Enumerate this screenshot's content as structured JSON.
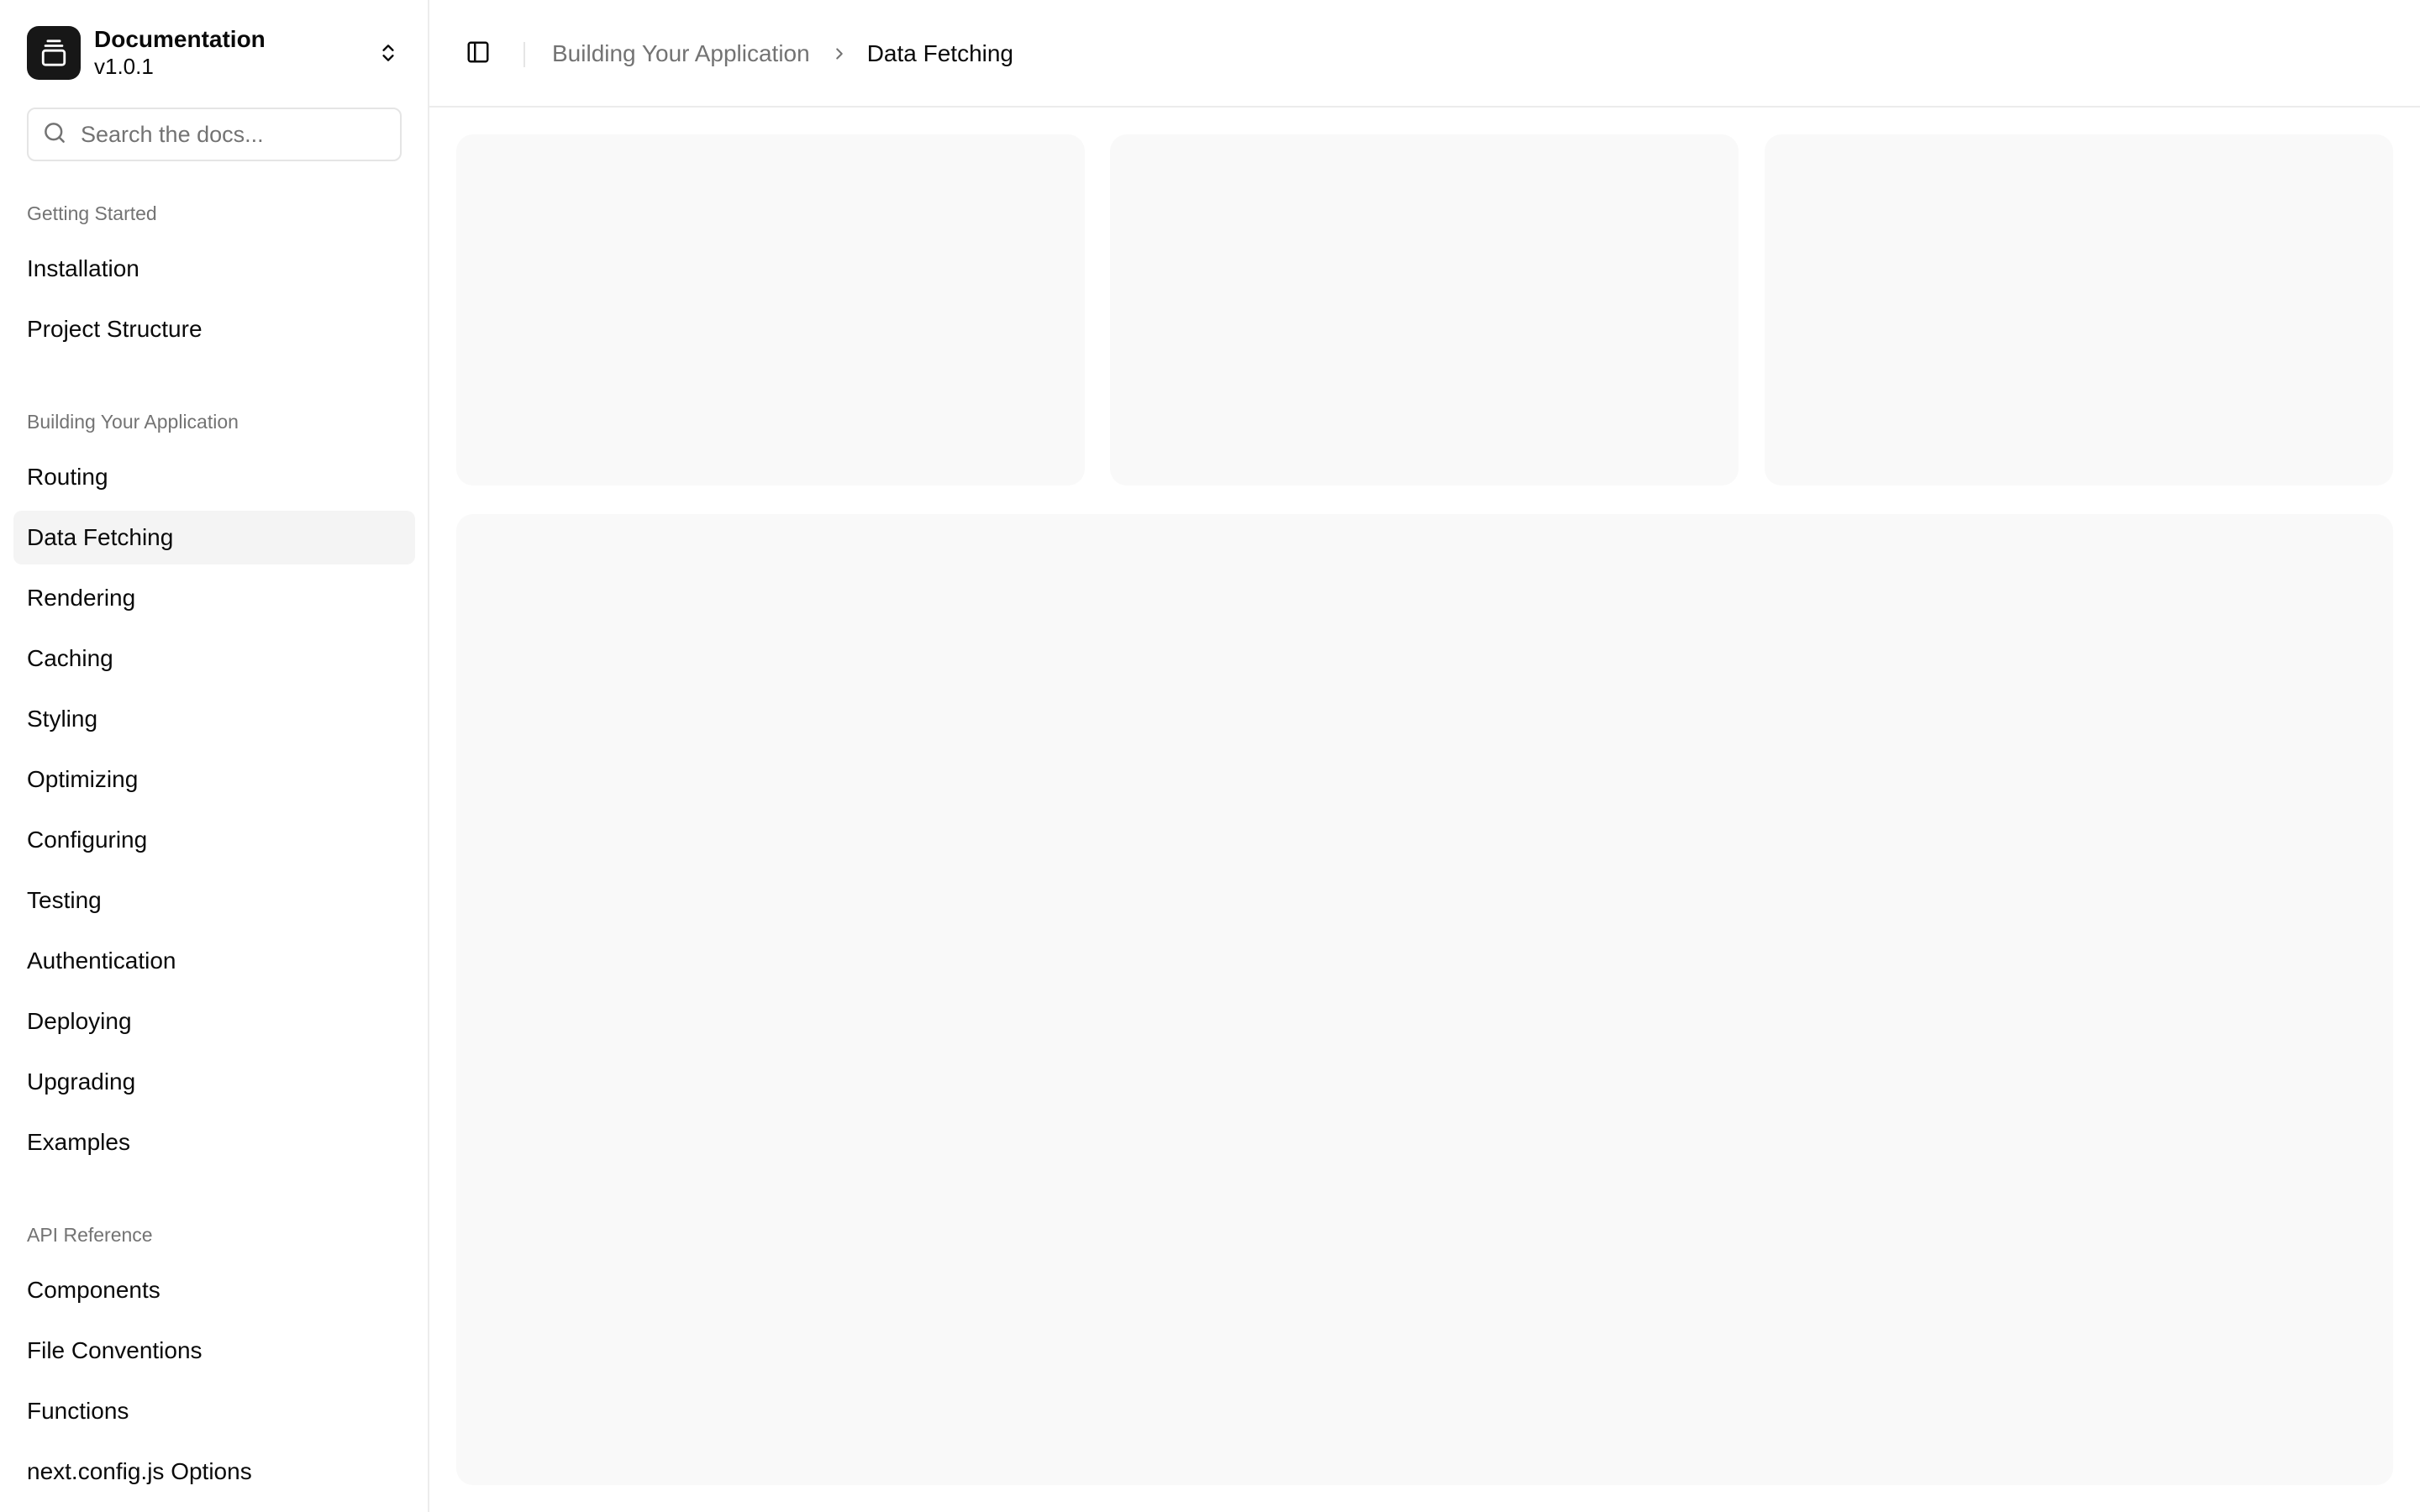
{
  "team": {
    "name": "Documentation",
    "version": "v1.0.1",
    "logo_icon": "gallery-vertical-end-icon",
    "switch_icon": "chevrons-up-down-icon"
  },
  "search": {
    "placeholder": "Search the docs..."
  },
  "sidebar": {
    "groups": [
      {
        "label": "Getting Started",
        "items": [
          {
            "label": "Installation"
          },
          {
            "label": "Project Structure"
          }
        ]
      },
      {
        "label": "Building Your Application",
        "items": [
          {
            "label": "Routing"
          },
          {
            "label": "Data Fetching",
            "active": true
          },
          {
            "label": "Rendering"
          },
          {
            "label": "Caching"
          },
          {
            "label": "Styling"
          },
          {
            "label": "Optimizing"
          },
          {
            "label": "Configuring"
          },
          {
            "label": "Testing"
          },
          {
            "label": "Authentication"
          },
          {
            "label": "Deploying"
          },
          {
            "label": "Upgrading"
          },
          {
            "label": "Examples"
          }
        ]
      },
      {
        "label": "API Reference",
        "items": [
          {
            "label": "Components"
          },
          {
            "label": "File Conventions"
          },
          {
            "label": "Functions"
          },
          {
            "label": "next.config.js Options"
          }
        ]
      }
    ]
  },
  "header": {
    "toggle_icon": "panel-left-icon",
    "breadcrumb": {
      "parent": "Building Your Application",
      "separator_icon": "chevron-right-icon",
      "current": "Data Fetching"
    }
  },
  "colors": {
    "accent": "#171717",
    "muted_text": "#737373",
    "active_bg": "#f4f4f4",
    "skeleton_bg": "#f9f9f9",
    "border": "#ececec"
  }
}
